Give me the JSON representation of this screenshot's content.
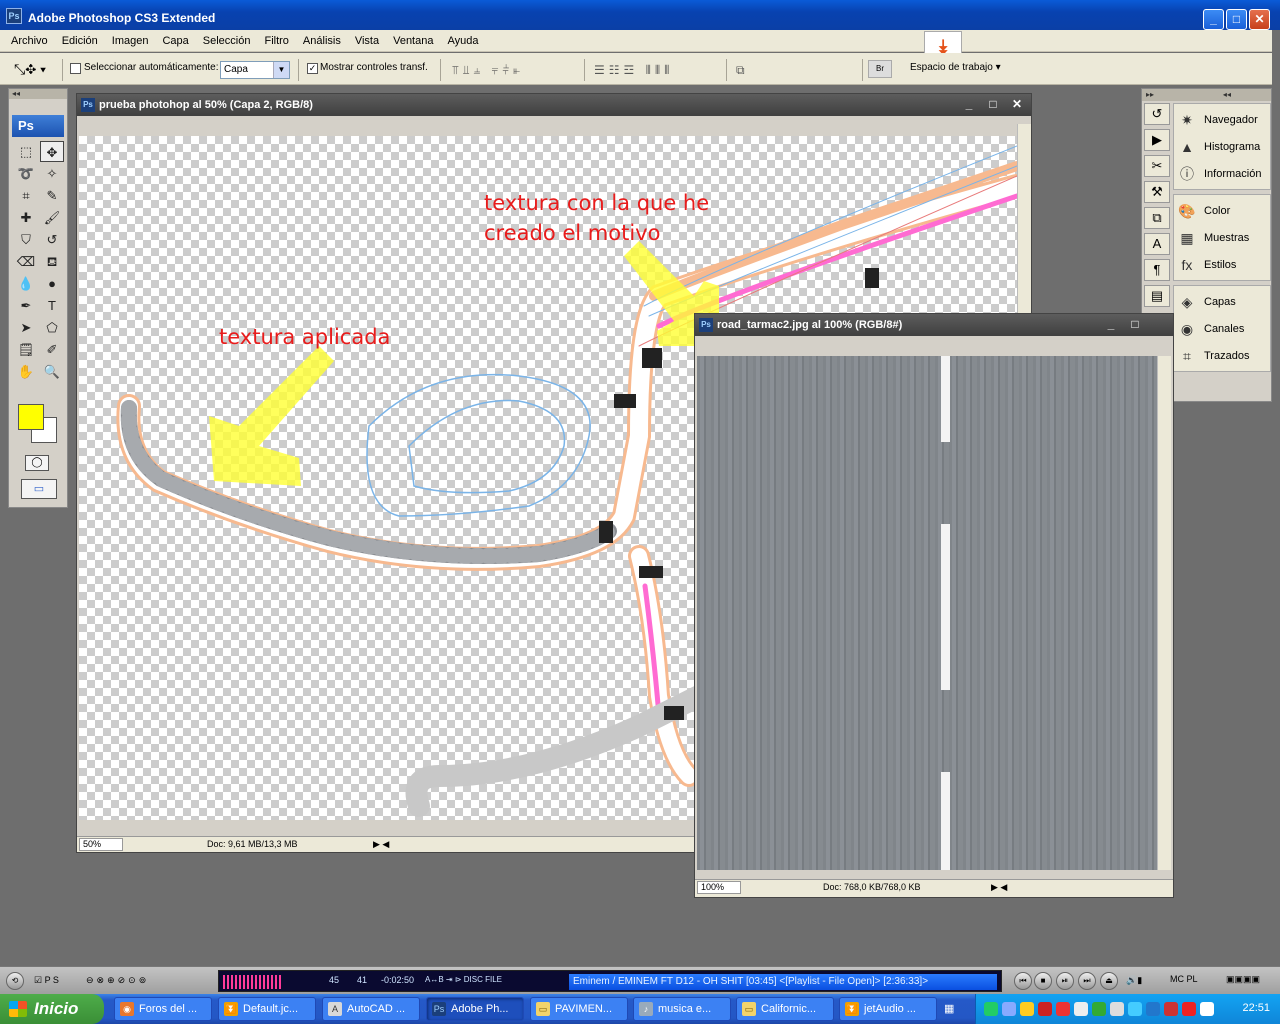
{
  "app": {
    "title": "Adobe Photoshop CS3 Extended",
    "icon": "Ps"
  },
  "menu": [
    "Archivo",
    "Edición",
    "Imagen",
    "Capa",
    "Selección",
    "Filtro",
    "Análisis",
    "Vista",
    "Ventana",
    "Ayuda"
  ],
  "options": {
    "auto_select_label": "Seleccionar automáticamente:",
    "auto_select_checked": false,
    "auto_select_value": "Capa",
    "show_transform_label": "Mostrar controles transf.",
    "show_transform_checked": true,
    "workspace_label": "Espacio de trabajo"
  },
  "tools_panel": {
    "logo": "Ps",
    "foreground_color": "#ffff00",
    "background_color": "#ffffff"
  },
  "doc1": {
    "title": "prueba photohop al 50% (Capa 2, RGB/8)",
    "zoom": "50%",
    "docinfo": "Doc: 9,61 MB/13,3 MB",
    "annotation_applied": "textura aplicada",
    "annotation_source_line1": "textura con la que he",
    "annotation_source_line2": "creado el motivo"
  },
  "doc2": {
    "title": "road_tarmac2.jpg al 100% (RGB/8#)",
    "zoom": "100%",
    "docinfo": "Doc: 768,0 KB/768,0 KB"
  },
  "panels": {
    "group1": [
      "Navegador",
      "Histograma",
      "Información"
    ],
    "group2": [
      "Color",
      "Muestras",
      "Estilos"
    ],
    "group3": [
      "Capas",
      "Canales",
      "Trazados"
    ]
  },
  "media_player": {
    "track": "Eminem / EMINEM FT D12 - OH SHIT  [03:45]     <[Playlist - File Open]> [2:36:33]>",
    "counter_a": "45",
    "counter_b": "41",
    "time": "-0:02:50",
    "labels": "A↔B  ⇥  ⊳   DISC  FILE"
  },
  "taskbar": {
    "start": "Inicio",
    "tasks": [
      "Foros del ...",
      "Default.jc...",
      "AutoCAD ...",
      "Adobe Ph...",
      "PAVIMEN...",
      "musica e...",
      "Californic...",
      "jetAudio ..."
    ],
    "clock": "22:51"
  }
}
